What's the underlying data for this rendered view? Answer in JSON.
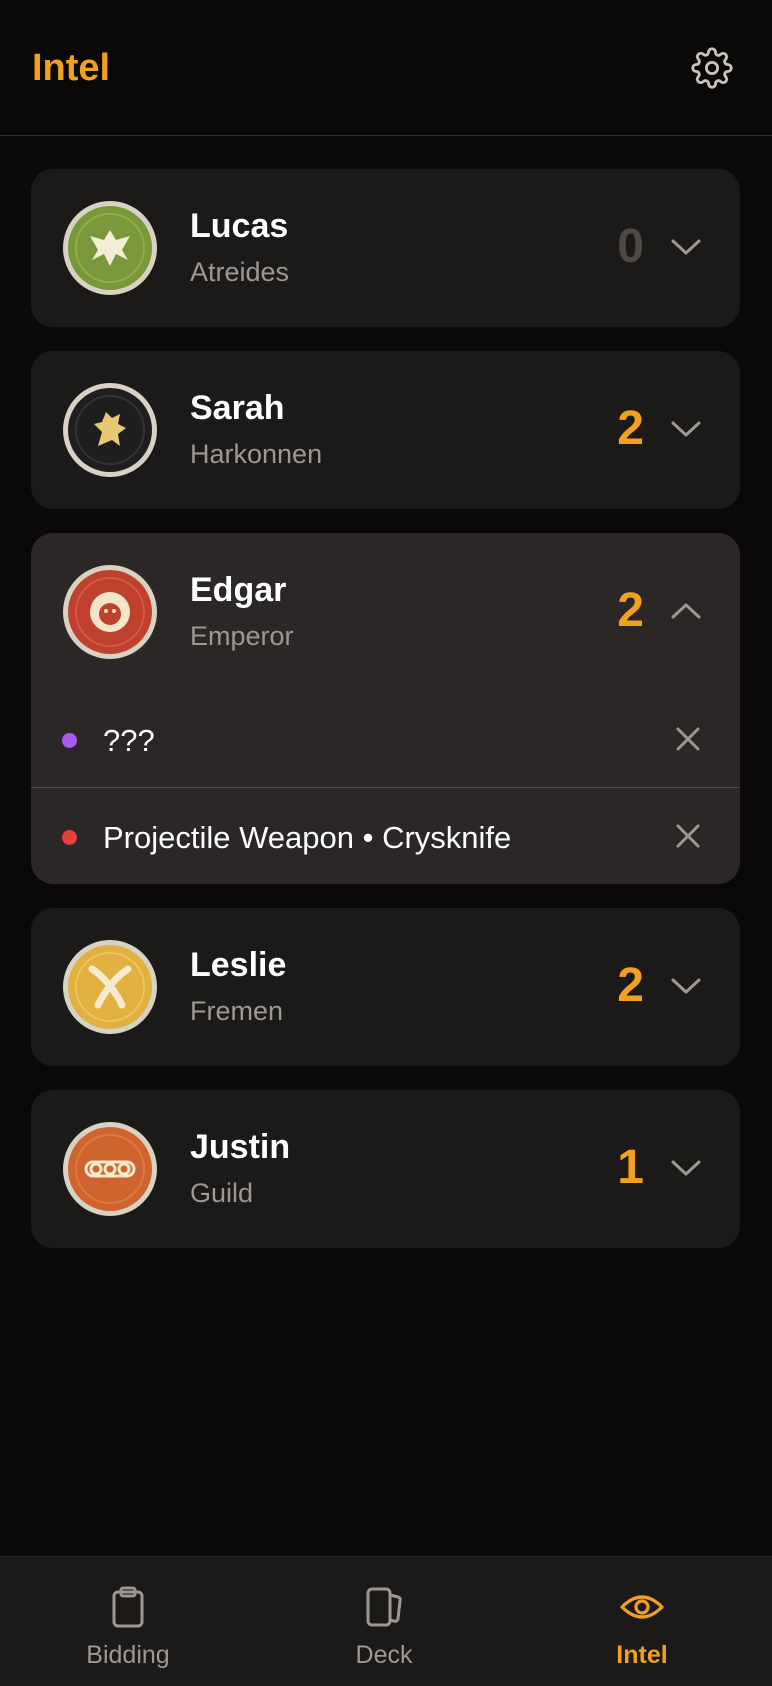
{
  "header": {
    "title": "Intel",
    "settings_icon": "gear-icon"
  },
  "colors": {
    "accent": "#f2a01e",
    "card": "#1c1a19",
    "card_expanded": "#2a2726",
    "muted_text": "#9c9894",
    "zero_count": "#4d4a46"
  },
  "players": [
    {
      "name": "Lucas",
      "faction": "Atreides",
      "count": "0",
      "expanded": false,
      "emblem": "hawk-icon",
      "emblem_color": "#7a9a3a"
    },
    {
      "name": "Sarah",
      "faction": "Harkonnen",
      "count": "2",
      "expanded": false,
      "emblem": "griffin-icon",
      "emblem_color": "#222222"
    },
    {
      "name": "Edgar",
      "faction": "Emperor",
      "count": "2",
      "expanded": true,
      "emblem": "lion-icon",
      "emblem_color": "#c0402e",
      "intel": [
        {
          "text": "???",
          "dot_color": "#a95af2"
        },
        {
          "text": "Projectile Weapon • Crysknife",
          "dot_color": "#e5403a"
        }
      ]
    },
    {
      "name": "Leslie",
      "faction": "Fremen",
      "count": "2",
      "expanded": false,
      "emblem": "crossed-knives-icon",
      "emblem_color": "#e0b040"
    },
    {
      "name": "Justin",
      "faction": "Guild",
      "count": "1",
      "expanded": false,
      "emblem": "rings-icon",
      "emblem_color": "#d0642e"
    }
  ],
  "tabbar": {
    "tabs": [
      {
        "label": "Bidding",
        "icon": "clipboard-icon",
        "active": false
      },
      {
        "label": "Deck",
        "icon": "cards-icon",
        "active": false
      },
      {
        "label": "Intel",
        "icon": "eye-icon",
        "active": true
      }
    ]
  }
}
